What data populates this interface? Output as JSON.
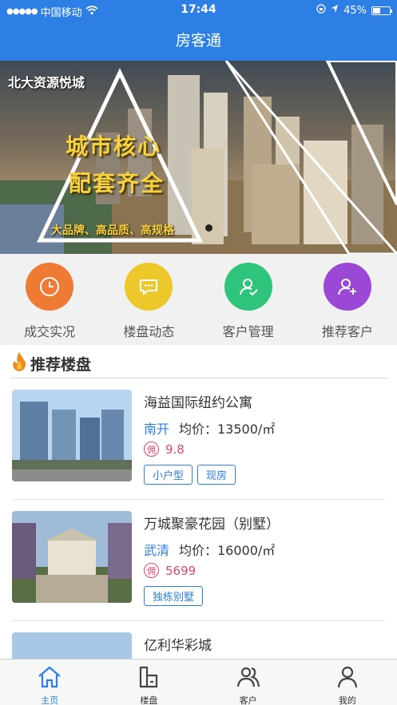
{
  "status_bar": {
    "carrier": "中国移动",
    "time": "17:44",
    "battery": "45%",
    "battery_level": 0.45
  },
  "nav": {
    "title": "房客通"
  },
  "banner": {
    "brand": "北大资源悦城",
    "headline_1": "城市核心",
    "headline_2": "配套齐全",
    "subline": "大品牌、高品质、高规格"
  },
  "quick_menu": [
    {
      "label": "成交实况",
      "icon": "clock-icon",
      "color": "#ee7a33"
    },
    {
      "label": "楼盘动态",
      "icon": "message-icon",
      "color": "#edc82a"
    },
    {
      "label": "客户管理",
      "icon": "user-check-icon",
      "color": "#2fc47b"
    },
    {
      "label": "推荐客户",
      "icon": "user-add-icon",
      "color": "#9b48d6"
    }
  ],
  "section": {
    "title": "推荐楼盘"
  },
  "listings": [
    {
      "name": "海益国际纽约公寓",
      "area": "南开",
      "price": "均价：13500/㎡",
      "commission_badge": "佣",
      "commission": "9.8",
      "tags": [
        "小户型",
        "现房"
      ]
    },
    {
      "name": "万城聚豪花园（别墅）",
      "area": "武清",
      "price": "均价：16000/㎡",
      "commission_badge": "佣",
      "commission": "5699",
      "tags": [
        "独栋别墅"
      ]
    },
    {
      "name": "亿利华彩城"
    }
  ],
  "tab_bar": [
    {
      "label": "主页",
      "icon": "home-icon",
      "active": true
    },
    {
      "label": "楼盘",
      "icon": "building-icon",
      "active": false
    },
    {
      "label": "客户",
      "icon": "customers-icon",
      "active": false
    },
    {
      "label": "我的",
      "icon": "profile-icon",
      "active": false
    }
  ],
  "colors": {
    "primary": "#2d7fe6",
    "commission": "#e3446b",
    "banner_text": "#f7d23c"
  }
}
